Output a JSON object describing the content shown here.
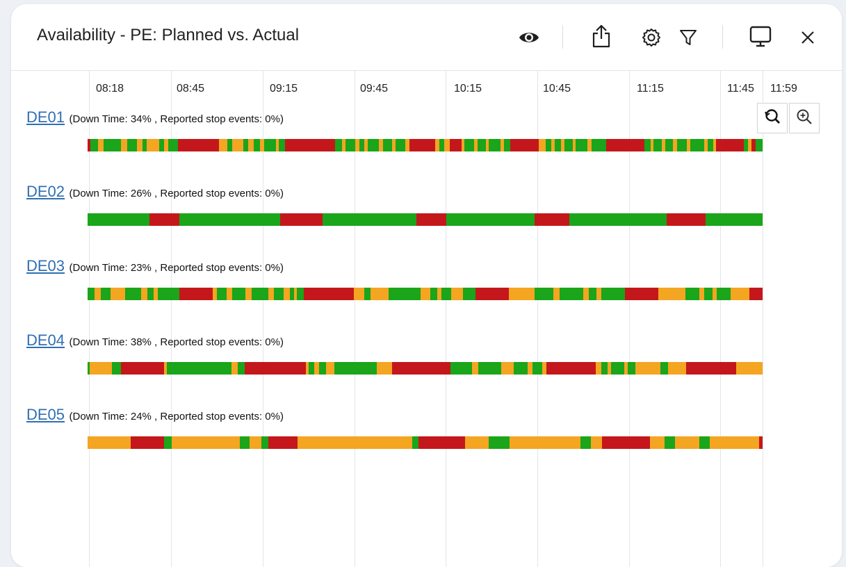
{
  "header": {
    "title": "Availability - PE: Planned vs. Actual"
  },
  "icons": {
    "view": "eye-icon",
    "share": "share-icon",
    "settings": "gear-icon",
    "filter": "filter-icon",
    "display": "monitor-icon",
    "close": "close-icon",
    "zoom_out": "zoom-reset-icon",
    "zoom_in": "zoom-in-icon"
  },
  "colors": {
    "running": "#1aa51a",
    "partial": "#f4a521",
    "down": "#c4171c",
    "link": "#2f6fb2"
  },
  "axis": {
    "ticks": [
      "08:18",
      "08:45",
      "09:15",
      "09:45",
      "10:15",
      "10:45",
      "11:15",
      "11:45",
      "11:59"
    ]
  },
  "rows": [
    {
      "name": "DE01",
      "stats": "(Down Time: 34% , Reported stop events: 0%)",
      "segments": [
        [
          "R",
          0.4
        ],
        [
          "G",
          1.1
        ],
        [
          "O",
          0.8
        ],
        [
          "G",
          2.4
        ],
        [
          "O",
          0.9
        ],
        [
          "G",
          1.4
        ],
        [
          "O",
          0.8
        ],
        [
          "G",
          0.6
        ],
        [
          "O",
          1.8
        ],
        [
          "G",
          0.7
        ],
        [
          "O",
          0.6
        ],
        [
          "G",
          1.3
        ],
        [
          "R",
          5.9
        ],
        [
          "O",
          1.2
        ],
        [
          "G",
          0.7
        ],
        [
          "O",
          1.5
        ],
        [
          "G",
          0.7
        ],
        [
          "O",
          0.8
        ],
        [
          "G",
          0.9
        ],
        [
          "O",
          0.6
        ],
        [
          "G",
          1.7
        ],
        [
          "O",
          0.4
        ],
        [
          "G",
          0.9
        ],
        [
          "R",
          7.1
        ],
        [
          "G",
          1.0
        ],
        [
          "O",
          0.5
        ],
        [
          "G",
          1.3
        ],
        [
          "O",
          0.6
        ],
        [
          "G",
          0.7
        ],
        [
          "O",
          0.5
        ],
        [
          "G",
          1.6
        ],
        [
          "O",
          0.6
        ],
        [
          "G",
          1.3
        ],
        [
          "O",
          0.5
        ],
        [
          "G",
          1.4
        ],
        [
          "O",
          0.6
        ],
        [
          "R",
          3.6
        ],
        [
          "O",
          0.6
        ],
        [
          "G",
          0.7
        ],
        [
          "O",
          0.8
        ],
        [
          "R",
          1.7
        ],
        [
          "O",
          0.4
        ],
        [
          "G",
          1.3
        ],
        [
          "O",
          0.5
        ],
        [
          "G",
          1.2
        ],
        [
          "O",
          0.4
        ],
        [
          "G",
          1.7
        ],
        [
          "O",
          0.5
        ],
        [
          "G",
          0.9
        ],
        [
          "R",
          4.0
        ],
        [
          "O",
          1.0
        ],
        [
          "G",
          0.8
        ],
        [
          "O",
          0.5
        ],
        [
          "G",
          0.9
        ],
        [
          "O",
          0.5
        ],
        [
          "G",
          1.2
        ],
        [
          "O",
          0.4
        ],
        [
          "G",
          1.6
        ],
        [
          "O",
          0.6
        ],
        [
          "G",
          2.1
        ],
        [
          "R",
          5.4
        ],
        [
          "G",
          0.9
        ],
        [
          "O",
          0.4
        ],
        [
          "G",
          1.2
        ],
        [
          "O",
          0.5
        ],
        [
          "G",
          1.1
        ],
        [
          "O",
          0.6
        ],
        [
          "G",
          1.4
        ],
        [
          "O",
          0.5
        ],
        [
          "G",
          1.9
        ],
        [
          "O",
          0.5
        ],
        [
          "G",
          0.8
        ],
        [
          "O",
          0.4
        ],
        [
          "R",
          4.0
        ],
        [
          "G",
          0.6
        ],
        [
          "O",
          0.5
        ],
        [
          "R",
          0.6
        ],
        [
          "G",
          0.9
        ]
      ]
    },
    {
      "name": "DE02",
      "stats": "(Down Time: 26% , Reported stop events: 0%)",
      "segments": [
        [
          "G",
          9.2
        ],
        [
          "R",
          4.4
        ],
        [
          "G",
          14.9
        ],
        [
          "R",
          6.3
        ],
        [
          "G",
          13.9
        ],
        [
          "R",
          4.4
        ],
        [
          "G",
          13.1
        ],
        [
          "R",
          5.2
        ],
        [
          "G",
          14.4
        ],
        [
          "R",
          5.8
        ],
        [
          "G",
          8.4
        ]
      ]
    },
    {
      "name": "DE03",
      "stats": "(Down Time: 23% , Reported stop events: 0%)",
      "segments": [
        [
          "G",
          1.0
        ],
        [
          "O",
          0.8
        ],
        [
          "G",
          1.4
        ],
        [
          "O",
          2.0
        ],
        [
          "G",
          2.2
        ],
        [
          "O",
          0.8
        ],
        [
          "G",
          0.9
        ],
        [
          "O",
          0.6
        ],
        [
          "G",
          2.9
        ],
        [
          "R",
          4.6
        ],
        [
          "O",
          0.6
        ],
        [
          "G",
          1.3
        ],
        [
          "O",
          0.8
        ],
        [
          "G",
          1.8
        ],
        [
          "O",
          0.9
        ],
        [
          "G",
          2.3
        ],
        [
          "O",
          0.7
        ],
        [
          "G",
          1.4
        ],
        [
          "O",
          0.8
        ],
        [
          "G",
          0.6
        ],
        [
          "O",
          0.4
        ],
        [
          "G",
          0.9
        ],
        [
          "R",
          6.9
        ],
        [
          "O",
          1.5
        ],
        [
          "G",
          0.8
        ],
        [
          "O",
          2.5
        ],
        [
          "G",
          4.4
        ],
        [
          "O",
          1.3
        ],
        [
          "G",
          1.0
        ],
        [
          "O",
          0.6
        ],
        [
          "G",
          1.3
        ],
        [
          "O",
          1.6
        ],
        [
          "G",
          1.8
        ],
        [
          "R",
          4.5
        ],
        [
          "O",
          3.6
        ],
        [
          "G",
          2.6
        ],
        [
          "O",
          0.8
        ],
        [
          "G",
          3.3
        ],
        [
          "O",
          0.7
        ],
        [
          "G",
          1.1
        ],
        [
          "O",
          0.7
        ],
        [
          "G",
          3.2
        ],
        [
          "R",
          4.6
        ],
        [
          "O",
          3.7
        ],
        [
          "G",
          1.9
        ],
        [
          "O",
          0.7
        ],
        [
          "G",
          1.2
        ],
        [
          "O",
          0.5
        ],
        [
          "G",
          1.9
        ],
        [
          "O",
          2.6
        ],
        [
          "R",
          1.8
        ]
      ]
    },
    {
      "name": "DE04",
      "stats": "(Down Time: 38% , Reported stop events: 0%)",
      "segments": [
        [
          "G",
          0.3
        ],
        [
          "O",
          3.2
        ],
        [
          "G",
          1.3
        ],
        [
          "R",
          6.3
        ],
        [
          "O",
          0.4
        ],
        [
          "G",
          9.4
        ],
        [
          "O",
          0.9
        ],
        [
          "G",
          1.0
        ],
        [
          "R",
          8.9
        ],
        [
          "O",
          0.4
        ],
        [
          "G",
          0.8
        ],
        [
          "O",
          0.7
        ],
        [
          "G",
          1.0
        ],
        [
          "O",
          1.2
        ],
        [
          "G",
          6.2
        ],
        [
          "O",
          2.2
        ],
        [
          "R",
          8.4
        ],
        [
          "G",
          3.2
        ],
        [
          "O",
          0.9
        ],
        [
          "G",
          3.3
        ],
        [
          "O",
          1.8
        ],
        [
          "G",
          2.0
        ],
        [
          "O",
          0.7
        ],
        [
          "G",
          1.5
        ],
        [
          "O",
          0.6
        ],
        [
          "R",
          7.1
        ],
        [
          "O",
          0.8
        ],
        [
          "G",
          0.9
        ],
        [
          "O",
          0.5
        ],
        [
          "G",
          2.0
        ],
        [
          "O",
          0.5
        ],
        [
          "G",
          1.1
        ],
        [
          "O",
          3.6
        ],
        [
          "G",
          1.1
        ],
        [
          "O",
          2.6
        ],
        [
          "R",
          7.3
        ],
        [
          "O",
          3.8
        ]
      ]
    },
    {
      "name": "DE05",
      "stats": "(Down Time: 24% , Reported stop events: 0%)",
      "segments": [
        [
          "O",
          6.4
        ],
        [
          "R",
          4.9
        ],
        [
          "G",
          1.1
        ],
        [
          "O",
          10.0
        ],
        [
          "G",
          1.5
        ],
        [
          "O",
          1.7
        ],
        [
          "G",
          1.0
        ],
        [
          "R",
          4.4
        ],
        [
          "O",
          16.9
        ],
        [
          "G",
          0.9
        ],
        [
          "R",
          6.8
        ],
        [
          "O",
          3.5
        ],
        [
          "G",
          3.1
        ],
        [
          "O",
          10.5
        ],
        [
          "G",
          1.5
        ],
        [
          "O",
          1.6
        ],
        [
          "R",
          7.1
        ],
        [
          "O",
          2.2
        ],
        [
          "G",
          1.5
        ],
        [
          "O",
          3.6
        ],
        [
          "G",
          1.5
        ],
        [
          "O",
          7.3
        ],
        [
          "R",
          0.5
        ]
      ]
    }
  ]
}
